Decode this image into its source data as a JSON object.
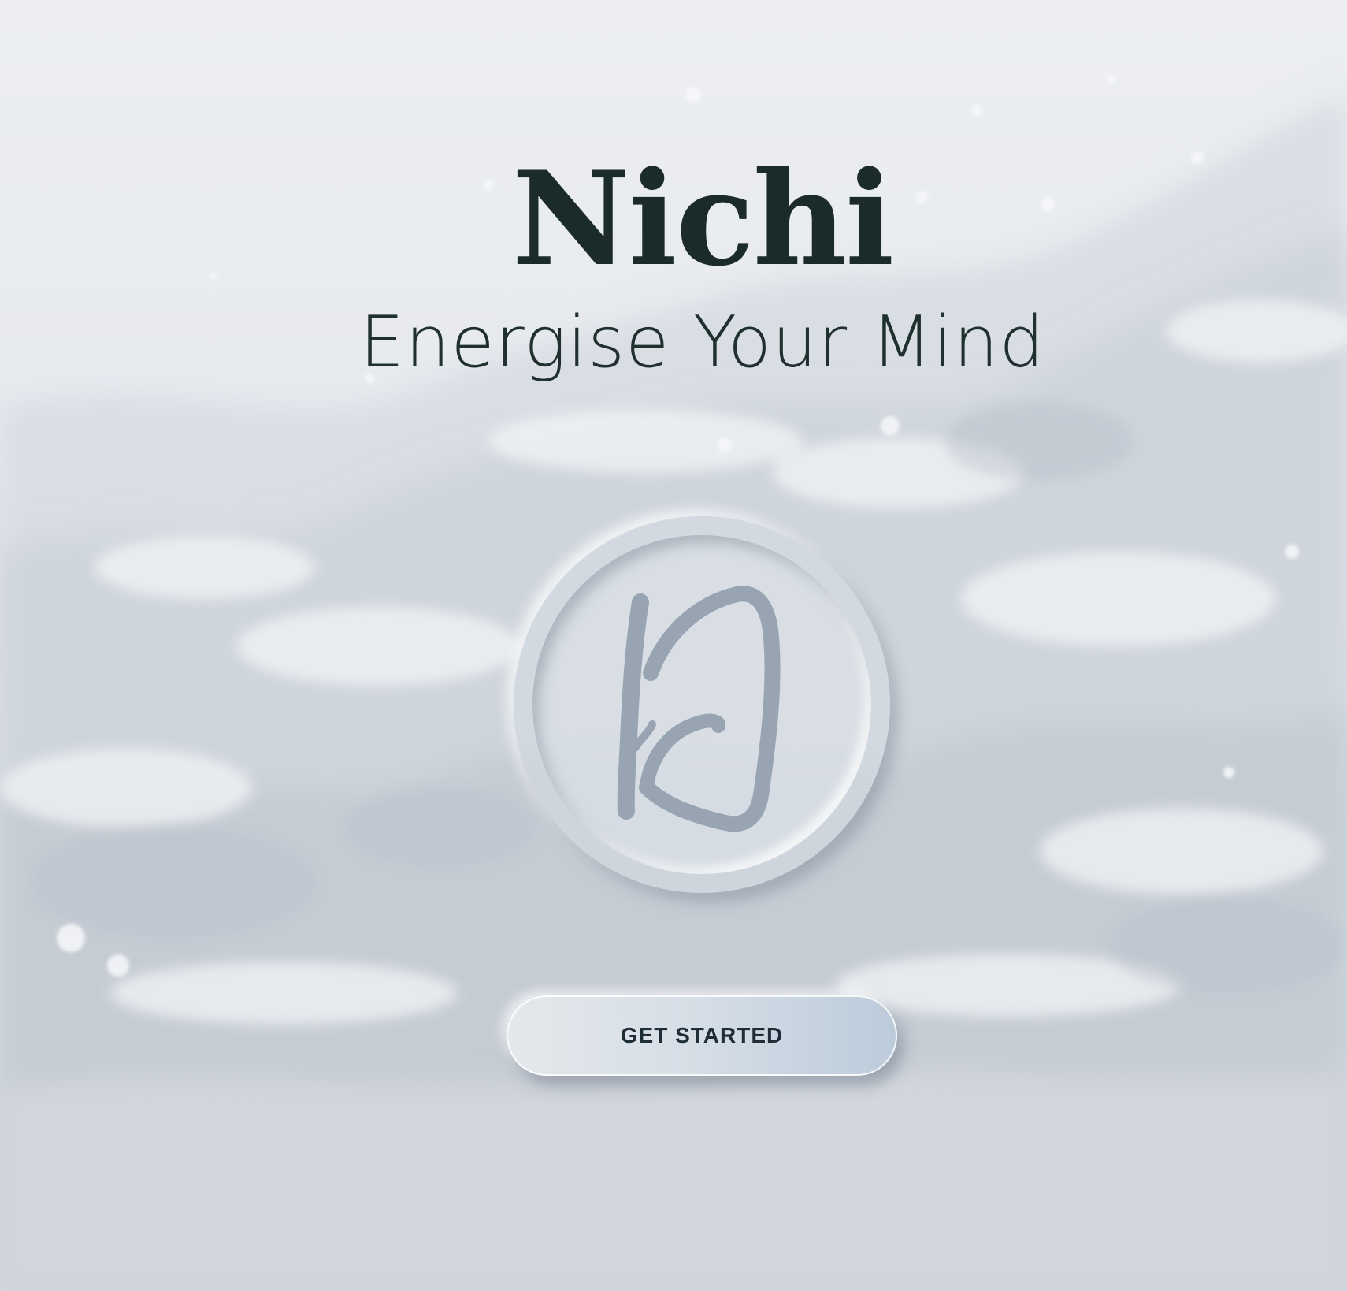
{
  "app": {
    "title": "Nichi",
    "tagline": "Energise Your Mind"
  },
  "logo": {
    "icon": "nichi-brush-logo-icon"
  },
  "actions": {
    "get_started_label": "GET STARTED"
  },
  "colors": {
    "title": "#1b2a2a",
    "background": "#e6e9ed",
    "logo_stroke": "#98a4b2",
    "button_gradient_start": "#e4e8ec",
    "button_gradient_end": "#bccbdb"
  }
}
